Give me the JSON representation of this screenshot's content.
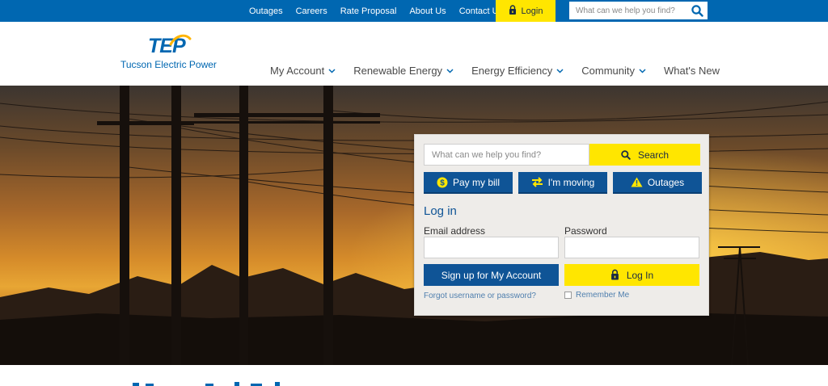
{
  "topbar": {
    "links": [
      "Outages",
      "Careers",
      "Rate Proposal",
      "About Us",
      "Contact Us"
    ],
    "login_label": "Login",
    "search_placeholder": "What can we help you find?"
  },
  "logo": {
    "mark": "TEP",
    "name": "Tucson Electric Power"
  },
  "nav": [
    {
      "label": "My Account",
      "has_dropdown": true
    },
    {
      "label": "Renewable Energy",
      "has_dropdown": true
    },
    {
      "label": "Energy Efficiency",
      "has_dropdown": true
    },
    {
      "label": "Community",
      "has_dropdown": true
    },
    {
      "label": "What's New",
      "has_dropdown": false
    }
  ],
  "panel": {
    "search_placeholder": "What can we help you find?",
    "search_label": "Search",
    "quick": [
      {
        "label": "Pay my bill",
        "icon": "dollar-icon"
      },
      {
        "label": "I'm moving",
        "icon": "swap-arrows-icon"
      },
      {
        "label": "Outages",
        "icon": "warning-icon"
      }
    ],
    "login_title": "Log in",
    "email_label": "Email address",
    "password_label": "Password",
    "signup_label": "Sign up for My Account",
    "login_label": "Log In",
    "forgot_label": "Forgot username or password?",
    "remember_label": "Remember Me"
  },
  "colors": {
    "brand_blue": "#0067b1",
    "button_blue": "#0f5496",
    "accent_yellow": "#ffe600"
  }
}
